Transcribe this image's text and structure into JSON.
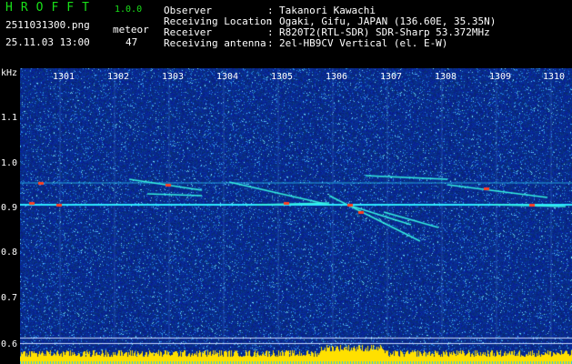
{
  "app": {
    "name": "HROFFT",
    "version": "1.0.0"
  },
  "file": {
    "name": "2511031300.png",
    "datetime": "25.11.03 13:00"
  },
  "meteor": {
    "label": "meteor",
    "count": "47"
  },
  "station": [
    {
      "key": "Observer",
      "sep": ":",
      "value": "Takanori Kawachi"
    },
    {
      "key": "Receiving Location",
      "sep": ":",
      "value": "Ogaki, Gifu, JAPAN (136.60E, 35.35N)"
    },
    {
      "key": "Receiver",
      "sep": ":",
      "value": "R820T2(RTL-SDR) SDR-Sharp 53.372MHz"
    },
    {
      "key": "Receiving antenna",
      "sep": ":",
      "value": "2el-HB9CV Vertical (el. E-W)"
    }
  ],
  "yaxis": {
    "unit": "kHz",
    "ticks": [
      "1.1",
      "1.0",
      "0.9",
      "0.8",
      "0.7",
      "0.6"
    ]
  },
  "xaxis": {
    "ticks": [
      "1301",
      "1302",
      "1303",
      "1304",
      "1305",
      "1306",
      "1307",
      "1308",
      "1309",
      "1310"
    ]
  },
  "colors": {
    "background": "#000000",
    "spectrogram": "#0a2a8c",
    "signal": "#19e0ff",
    "hot": "#ff3020",
    "volume": "#ffe000",
    "text": "#ffffff",
    "accent": "#19e019"
  }
}
